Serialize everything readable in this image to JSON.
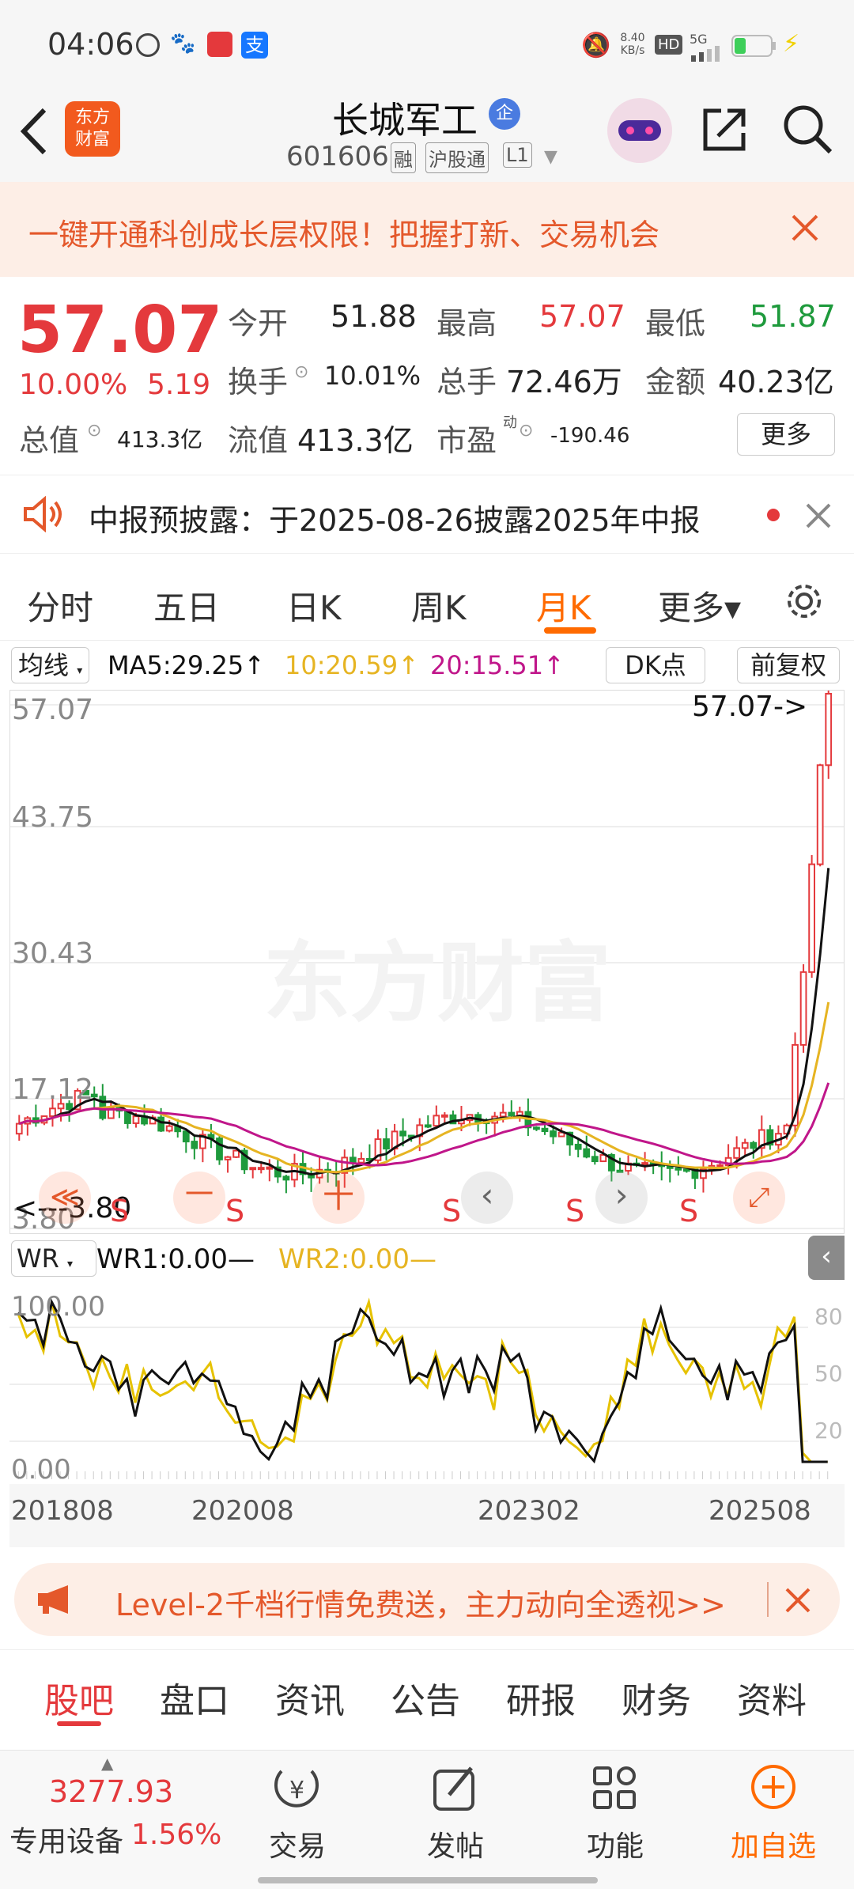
{
  "status": {
    "time": "04:06",
    "net_speed_top": "8.40",
    "net_speed_unit": "KB/s",
    "hd": "HD",
    "sig": "5G"
  },
  "header": {
    "title": "长城军工",
    "badge": "企",
    "code": "601606",
    "tag_rong": "融",
    "tag_hgt": "沪股通",
    "tag_level": "L1",
    "logo_line1": "东方",
    "logo_line2": "财富"
  },
  "promo": {
    "text": "一键开通科创成长层权限！把握打新、交易机会"
  },
  "quote": {
    "price": "57.07",
    "change_pct": "10.00%",
    "change_abs": "5.19",
    "open_label": "今开",
    "open": "51.88",
    "high_label": "最高",
    "high": "57.07",
    "low_label": "最低",
    "low": "51.87",
    "turnover_label": "换手",
    "turnover": "10.01%",
    "volume_label": "总手",
    "volume": "72.46万",
    "amount_label": "金额",
    "amount": "40.23亿",
    "mcap_label": "总值",
    "mcap": "413.3亿",
    "float_label": "流值",
    "float": "413.3亿",
    "pe_label": "市盈",
    "pe_sup": "动",
    "pe": "-190.46",
    "more": "更多"
  },
  "notice": {
    "text": "中报预披露：于2025-08-26披露2025年中报"
  },
  "tabs": [
    {
      "label": "分时"
    },
    {
      "label": "五日"
    },
    {
      "label": "日K"
    },
    {
      "label": "周K"
    },
    {
      "label": "月K",
      "active": true
    },
    {
      "label": "更多▾"
    }
  ],
  "indicator": {
    "name": "均线",
    "ma5": "MA5:29.25↑",
    "ma10": "10:20.59↑",
    "ma20": "20:15.51↑",
    "dk": "DK点",
    "fq": "前复权"
  },
  "kchart": {
    "y_labels": [
      "57.07",
      "43.75",
      "30.43",
      "17.12",
      "3.80"
    ],
    "max_label": "57.07->",
    "min_label": "<---3.80",
    "watermark": "东方财富",
    "signals": [
      "S",
      "S",
      "S",
      "S",
      "S"
    ],
    "ctrl": [
      "≪",
      "一",
      "十",
      "‹",
      "›",
      "⤢"
    ]
  },
  "wr": {
    "name": "WR",
    "wr1": "WR1:0.00—",
    "wr2": "WR2:0.00—",
    "y_left": [
      "100.00",
      "0.00"
    ],
    "y_right": [
      "80",
      "50",
      "20"
    ]
  },
  "dates": [
    "201808",
    "202008",
    "202302",
    "202508"
  ],
  "level2": {
    "text": "Level-2千档行情免费送，主力动向全透视>>"
  },
  "subtabs": [
    {
      "label": "股吧",
      "active": true
    },
    {
      "label": "盘口"
    },
    {
      "label": "资讯"
    },
    {
      "label": "公告"
    },
    {
      "label": "研报"
    },
    {
      "label": "财务"
    },
    {
      "label": "资料"
    }
  ],
  "bottom": {
    "index_value": "3277.93",
    "index_name": "专用设备",
    "index_pct": "1.56%",
    "trade": "交易",
    "post": "发帖",
    "func": "功能",
    "add": "加自选"
  },
  "colors": {
    "up": "#e4393c",
    "down": "#1e9a3c",
    "accent": "#ff6a00",
    "ma5": "#111111",
    "ma10": "#e6b422",
    "ma20": "#c0168a"
  },
  "chart_data": {
    "type": "candlestick",
    "ylim": [
      3.8,
      57.07
    ],
    "last_close": 57.07,
    "x_ticks": [
      "201808",
      "202008",
      "202302",
      "202508"
    ]
  }
}
